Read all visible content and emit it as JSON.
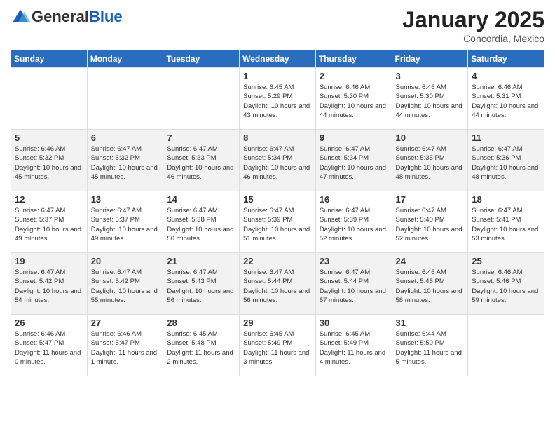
{
  "header": {
    "logo_general": "General",
    "logo_blue": "Blue",
    "month_title": "January 2025",
    "location": "Concordia, Mexico"
  },
  "weekdays": [
    "Sunday",
    "Monday",
    "Tuesday",
    "Wednesday",
    "Thursday",
    "Friday",
    "Saturday"
  ],
  "weeks": [
    [
      {
        "day": "",
        "sunrise": "",
        "sunset": "",
        "daylight": ""
      },
      {
        "day": "",
        "sunrise": "",
        "sunset": "",
        "daylight": ""
      },
      {
        "day": "",
        "sunrise": "",
        "sunset": "",
        "daylight": ""
      },
      {
        "day": "1",
        "sunrise": "Sunrise: 6:45 AM",
        "sunset": "Sunset: 5:29 PM",
        "daylight": "Daylight: 10 hours and 43 minutes."
      },
      {
        "day": "2",
        "sunrise": "Sunrise: 6:46 AM",
        "sunset": "Sunset: 5:30 PM",
        "daylight": "Daylight: 10 hours and 44 minutes."
      },
      {
        "day": "3",
        "sunrise": "Sunrise: 6:46 AM",
        "sunset": "Sunset: 5:30 PM",
        "daylight": "Daylight: 10 hours and 44 minutes."
      },
      {
        "day": "4",
        "sunrise": "Sunrise: 6:46 AM",
        "sunset": "Sunset: 5:31 PM",
        "daylight": "Daylight: 10 hours and 44 minutes."
      }
    ],
    [
      {
        "day": "5",
        "sunrise": "Sunrise: 6:46 AM",
        "sunset": "Sunset: 5:32 PM",
        "daylight": "Daylight: 10 hours and 45 minutes."
      },
      {
        "day": "6",
        "sunrise": "Sunrise: 6:47 AM",
        "sunset": "Sunset: 5:32 PM",
        "daylight": "Daylight: 10 hours and 45 minutes."
      },
      {
        "day": "7",
        "sunrise": "Sunrise: 6:47 AM",
        "sunset": "Sunset: 5:33 PM",
        "daylight": "Daylight: 10 hours and 46 minutes."
      },
      {
        "day": "8",
        "sunrise": "Sunrise: 6:47 AM",
        "sunset": "Sunset: 5:34 PM",
        "daylight": "Daylight: 10 hours and 46 minutes."
      },
      {
        "day": "9",
        "sunrise": "Sunrise: 6:47 AM",
        "sunset": "Sunset: 5:34 PM",
        "daylight": "Daylight: 10 hours and 47 minutes."
      },
      {
        "day": "10",
        "sunrise": "Sunrise: 6:47 AM",
        "sunset": "Sunset: 5:35 PM",
        "daylight": "Daylight: 10 hours and 48 minutes."
      },
      {
        "day": "11",
        "sunrise": "Sunrise: 6:47 AM",
        "sunset": "Sunset: 5:36 PM",
        "daylight": "Daylight: 10 hours and 48 minutes."
      }
    ],
    [
      {
        "day": "12",
        "sunrise": "Sunrise: 6:47 AM",
        "sunset": "Sunset: 5:37 PM",
        "daylight": "Daylight: 10 hours and 49 minutes."
      },
      {
        "day": "13",
        "sunrise": "Sunrise: 6:47 AM",
        "sunset": "Sunset: 5:37 PM",
        "daylight": "Daylight: 10 hours and 49 minutes."
      },
      {
        "day": "14",
        "sunrise": "Sunrise: 6:47 AM",
        "sunset": "Sunset: 5:38 PM",
        "daylight": "Daylight: 10 hours and 50 minutes."
      },
      {
        "day": "15",
        "sunrise": "Sunrise: 6:47 AM",
        "sunset": "Sunset: 5:39 PM",
        "daylight": "Daylight: 10 hours and 51 minutes."
      },
      {
        "day": "16",
        "sunrise": "Sunrise: 6:47 AM",
        "sunset": "Sunset: 5:39 PM",
        "daylight": "Daylight: 10 hours and 52 minutes."
      },
      {
        "day": "17",
        "sunrise": "Sunrise: 6:47 AM",
        "sunset": "Sunset: 5:40 PM",
        "daylight": "Daylight: 10 hours and 52 minutes."
      },
      {
        "day": "18",
        "sunrise": "Sunrise: 6:47 AM",
        "sunset": "Sunset: 5:41 PM",
        "daylight": "Daylight: 10 hours and 53 minutes."
      }
    ],
    [
      {
        "day": "19",
        "sunrise": "Sunrise: 6:47 AM",
        "sunset": "Sunset: 5:42 PM",
        "daylight": "Daylight: 10 hours and 54 minutes."
      },
      {
        "day": "20",
        "sunrise": "Sunrise: 6:47 AM",
        "sunset": "Sunset: 5:42 PM",
        "daylight": "Daylight: 10 hours and 55 minutes."
      },
      {
        "day": "21",
        "sunrise": "Sunrise: 6:47 AM",
        "sunset": "Sunset: 5:43 PM",
        "daylight": "Daylight: 10 hours and 56 minutes."
      },
      {
        "day": "22",
        "sunrise": "Sunrise: 6:47 AM",
        "sunset": "Sunset: 5:44 PM",
        "daylight": "Daylight: 10 hours and 56 minutes."
      },
      {
        "day": "23",
        "sunrise": "Sunrise: 6:47 AM",
        "sunset": "Sunset: 5:44 PM",
        "daylight": "Daylight: 10 hours and 57 minutes."
      },
      {
        "day": "24",
        "sunrise": "Sunrise: 6:46 AM",
        "sunset": "Sunset: 5:45 PM",
        "daylight": "Daylight: 10 hours and 58 minutes."
      },
      {
        "day": "25",
        "sunrise": "Sunrise: 6:46 AM",
        "sunset": "Sunset: 5:46 PM",
        "daylight": "Daylight: 10 hours and 59 minutes."
      }
    ],
    [
      {
        "day": "26",
        "sunrise": "Sunrise: 6:46 AM",
        "sunset": "Sunset: 5:47 PM",
        "daylight": "Daylight: 11 hours and 0 minutes."
      },
      {
        "day": "27",
        "sunrise": "Sunrise: 6:46 AM",
        "sunset": "Sunset: 5:47 PM",
        "daylight": "Daylight: 11 hours and 1 minute."
      },
      {
        "day": "28",
        "sunrise": "Sunrise: 6:45 AM",
        "sunset": "Sunset: 5:48 PM",
        "daylight": "Daylight: 11 hours and 2 minutes."
      },
      {
        "day": "29",
        "sunrise": "Sunrise: 6:45 AM",
        "sunset": "Sunset: 5:49 PM",
        "daylight": "Daylight: 11 hours and 3 minutes."
      },
      {
        "day": "30",
        "sunrise": "Sunrise: 6:45 AM",
        "sunset": "Sunset: 5:49 PM",
        "daylight": "Daylight: 11 hours and 4 minutes."
      },
      {
        "day": "31",
        "sunrise": "Sunrise: 6:44 AM",
        "sunset": "Sunset: 5:50 PM",
        "daylight": "Daylight: 11 hours and 5 minutes."
      },
      {
        "day": "",
        "sunrise": "",
        "sunset": "",
        "daylight": ""
      }
    ]
  ]
}
